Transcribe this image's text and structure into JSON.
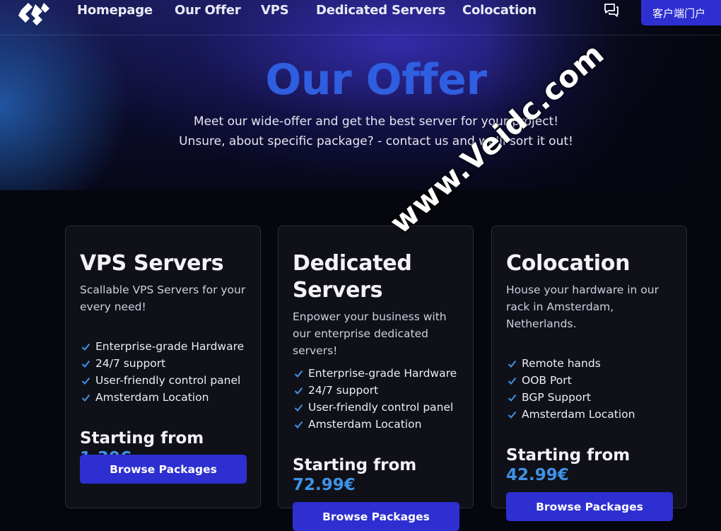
{
  "nav": {
    "links": [
      "Homepage",
      "Our Offer",
      "VPS",
      "Dedicated Servers",
      "Colocation"
    ],
    "portal_label": "客户端门户"
  },
  "hero": {
    "title": "Our Offer",
    "line1": "Meet our wide-offer and get the best server for your project!",
    "line2": "Unsure, about specific package? - contact us and we'll sort it out!"
  },
  "cards": [
    {
      "title": "VPS Servers",
      "description": "Scallable VPS Servers for your every need!",
      "features": [
        "Enterprise-grade Hardware",
        "24/7 support",
        "User-friendly control panel",
        "Amsterdam Location"
      ],
      "price_prefix": "Starting from",
      "price": "1.30€",
      "button": "Browse Packages"
    },
    {
      "title": "Dedicated Servers",
      "description": "Enpower your business with our enterprise dedicated servers!",
      "features": [
        "Enterprise-grade Hardware",
        "24/7 support",
        "User-friendly control panel",
        "Amsterdam Location"
      ],
      "price_prefix": "Starting from",
      "price": "72.99€",
      "button": "Browse Packages"
    },
    {
      "title": "Colocation",
      "description": "House your hardware in our rack in Amsterdam, Netherlands.",
      "features": [
        "Remote hands",
        "OOB Port",
        "BGP Support",
        "Amsterdam Location"
      ],
      "price_prefix": "Starting from",
      "price": "42.99€",
      "button": "Browse Packages"
    }
  ],
  "watermark": "www.Veidc.com",
  "colors": {
    "accent": "#2e2fd1",
    "title_blue": "#2f5ee0",
    "price_blue": "#3f92e6"
  },
  "icons": {
    "logo": "brand-logo",
    "chat": "chat-icon",
    "check": "check-icon"
  }
}
